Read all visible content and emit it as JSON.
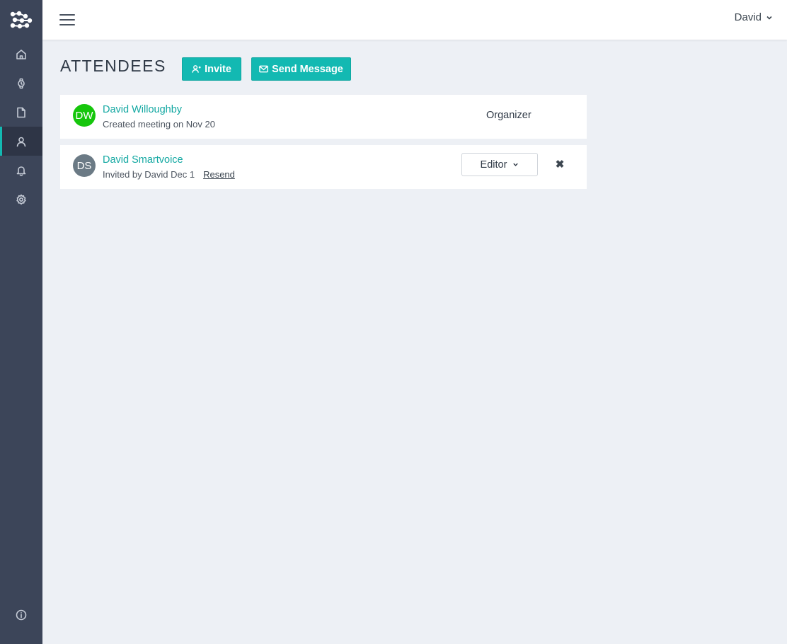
{
  "user_menu": {
    "name": "David"
  },
  "page": {
    "title": "ATTENDEES"
  },
  "actions": {
    "invite_label": "Invite",
    "send_message_label": "Send Message"
  },
  "attendees": [
    {
      "initials": "DW",
      "name": "David Willoughby",
      "subtitle": "Created meeting on Nov 20",
      "role": "Organizer",
      "avatar_color": "#16c60c"
    },
    {
      "initials": "DS",
      "name": "David Smartvoice",
      "subtitle": "Invited by David Dec 1",
      "resend_label": "Resend",
      "role": "Editor",
      "remove_symbol": "✖",
      "avatar_color": "#6b7a85"
    }
  ],
  "sidebar": {
    "items": [
      {
        "icon": "home-icon"
      },
      {
        "icon": "watch-icon"
      },
      {
        "icon": "document-icon"
      },
      {
        "icon": "user-icon",
        "active": true
      },
      {
        "icon": "bell-icon"
      },
      {
        "icon": "gear-icon"
      },
      {
        "icon": "info-icon"
      }
    ]
  },
  "colors": {
    "accent": "#13b9b2",
    "sidebar": "#3c4559",
    "background": "#edf0f5"
  }
}
